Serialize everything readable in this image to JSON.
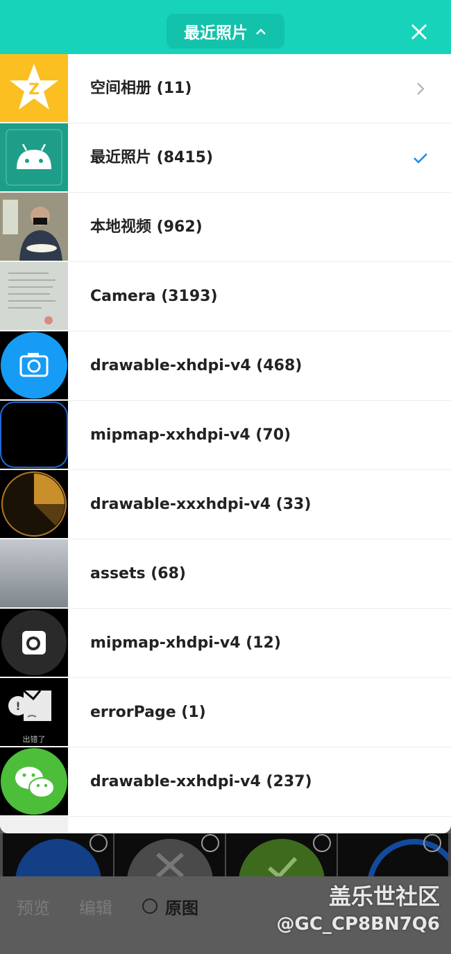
{
  "header": {
    "title": "最近照片",
    "title_chevron": "^",
    "close_icon": "close-icon",
    "color": "#17d3b9"
  },
  "albums": [
    {
      "label": "空间相册 (11)",
      "trailing": "chevron-right-icon",
      "thumb": "qzone-star-icon"
    },
    {
      "label": "最近照片 (8415)",
      "trailing": "checkmark-icon",
      "thumb": "android-robot-icon"
    },
    {
      "label": "本地视频 (962)",
      "trailing": "",
      "thumb": "video-person-thumbnail"
    },
    {
      "label": "Camera (3193)",
      "trailing": "",
      "thumb": "document-photo-thumbnail"
    },
    {
      "label": "drawable-xhdpi-v4 (468)",
      "trailing": "",
      "thumb": "camera-circle-icon"
    },
    {
      "label": "mipmap-xxhdpi-v4 (70)",
      "trailing": "",
      "thumb": "black-rounded-thumbnail"
    },
    {
      "label": "drawable-xxxhdpi-v4 (33)",
      "trailing": "",
      "thumb": "orange-sector-thumbnail"
    },
    {
      "label": "assets (68)",
      "trailing": "",
      "thumb": "gray-gradient-thumbnail"
    },
    {
      "label": "mipmap-xhdpi-v4 (12)",
      "trailing": "",
      "thumb": "camera-dark-circle-icon"
    },
    {
      "label": "errorPage (1)",
      "trailing": "",
      "thumb": "error-cloud-thumbnail",
      "thumb_caption": "出错了"
    },
    {
      "label": "drawable-xxhdpi-v4 (237)",
      "trailing": "",
      "thumb": "wechat-icon"
    }
  ],
  "bottom_bar": {
    "preview": "预览",
    "edit": "编辑",
    "original": "原图"
  },
  "watermark": {
    "line1": "盖乐世社区",
    "line2": "@GC_CP8BN7Q6"
  },
  "colors": {
    "accent": "#17d3b9",
    "check": "#1a8ae8",
    "qzone": "#fbbf22",
    "android": "#1e9e89",
    "camera_blue": "#169cf5",
    "wechat": "#4cbe3a"
  }
}
